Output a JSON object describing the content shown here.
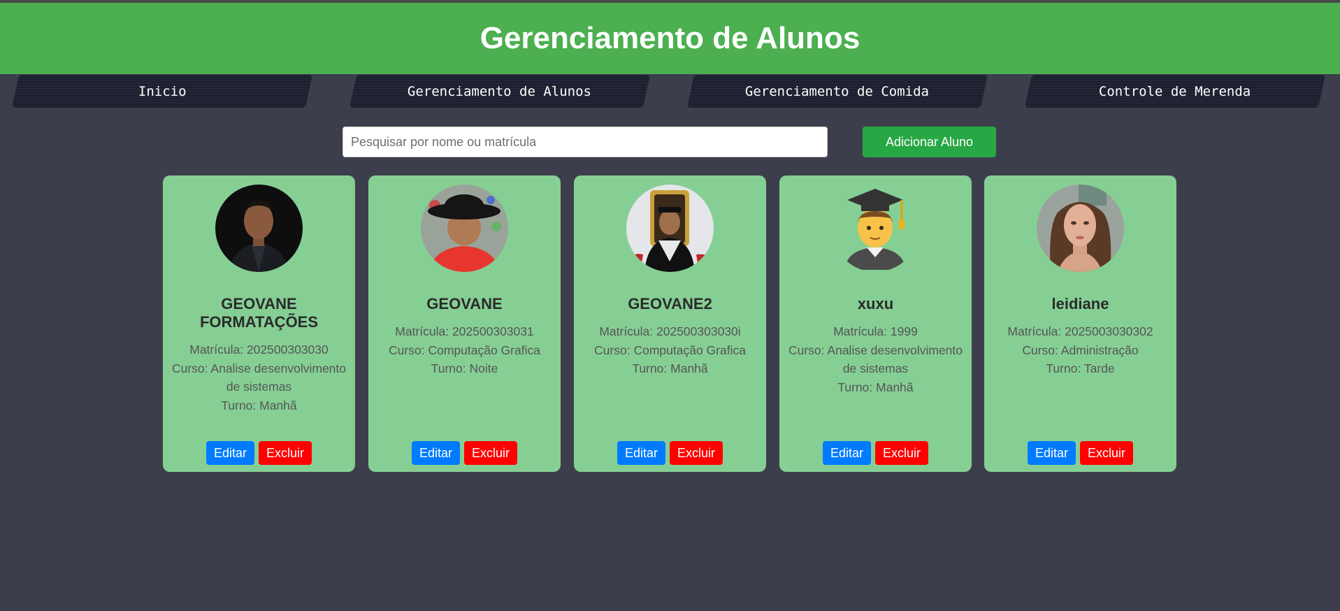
{
  "header": {
    "title": "Gerenciamento de Alunos"
  },
  "nav": {
    "items": [
      {
        "label": "Inicio"
      },
      {
        "label": "Gerenciamento de Alunos"
      },
      {
        "label": "Gerenciamento de Comida"
      },
      {
        "label": "Controle de Merenda"
      }
    ]
  },
  "search": {
    "placeholder": "Pesquisar por nome ou matrícula",
    "value": ""
  },
  "add_button": {
    "label": "Adicionar Aluno"
  },
  "colors": {
    "header": "#4caf50",
    "background": "#3d3e4b",
    "card": "#86cf94",
    "edit": "#007bff",
    "delete": "#ff0000",
    "add": "#28a745"
  },
  "cards": [
    {
      "name": "GEOVANE FORMATAÇÕES",
      "matricula": "Matrícula: 202500303030",
      "curso": "Curso: Analise desenvolvimento de sistemas",
      "turno": "Turno: Manhã",
      "edit_label": "Editar",
      "delete_label": "Excluir",
      "avatar": "photo"
    },
    {
      "name": "GEOVANE",
      "matricula": "Matrícula: 202500303031",
      "curso": "Curso: Computação Grafica",
      "turno": "Turno: Noite",
      "edit_label": "Editar",
      "delete_label": "Excluir",
      "avatar": "photo"
    },
    {
      "name": "GEOVANE2",
      "matricula": "Matrícula: 202500303030i",
      "curso": "Curso: Computação Grafica",
      "turno": "Turno: Manhã",
      "edit_label": "Editar",
      "delete_label": "Excluir",
      "avatar": "photo"
    },
    {
      "name": "xuxu",
      "matricula": "Matrícula: 1999",
      "curso": "Curso: Analise desenvolvimento de sistemas",
      "turno": "Turno: Manhã",
      "edit_label": "Editar",
      "delete_label": "Excluir",
      "avatar": "graduate-emoji"
    },
    {
      "name": "leidiane",
      "matricula": "Matrícula: 2025003030302",
      "curso": "Curso: Administração",
      "turno": "Turno: Tarde",
      "edit_label": "Editar",
      "delete_label": "Excluir",
      "avatar": "photo"
    }
  ]
}
